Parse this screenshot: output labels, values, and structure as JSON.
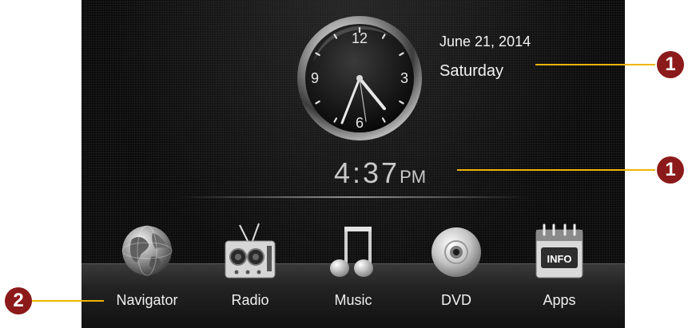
{
  "clock": {
    "numerals": [
      "12",
      "3",
      "6",
      "9"
    ],
    "date": "June 21, 2014",
    "day": "Saturday",
    "time_digits": "4:37",
    "time_ampm": "PM"
  },
  "apps": [
    {
      "label": "Navigator",
      "icon": "globe-icon"
    },
    {
      "label": "Radio",
      "icon": "radio-icon"
    },
    {
      "label": "Music",
      "icon": "music-note-icon"
    },
    {
      "label": "DVD",
      "icon": "dvd-disc-icon"
    },
    {
      "label": "Apps",
      "icon": "info-calendar-icon",
      "icon_text": "INFO"
    }
  ],
  "callouts": {
    "date_callout": "1",
    "time_callout": "1",
    "dock_callout": "2"
  },
  "colors": {
    "callout_line": "#f0b400",
    "badge": "#8c1a1a",
    "screen_bg": "#0b0b0b"
  }
}
